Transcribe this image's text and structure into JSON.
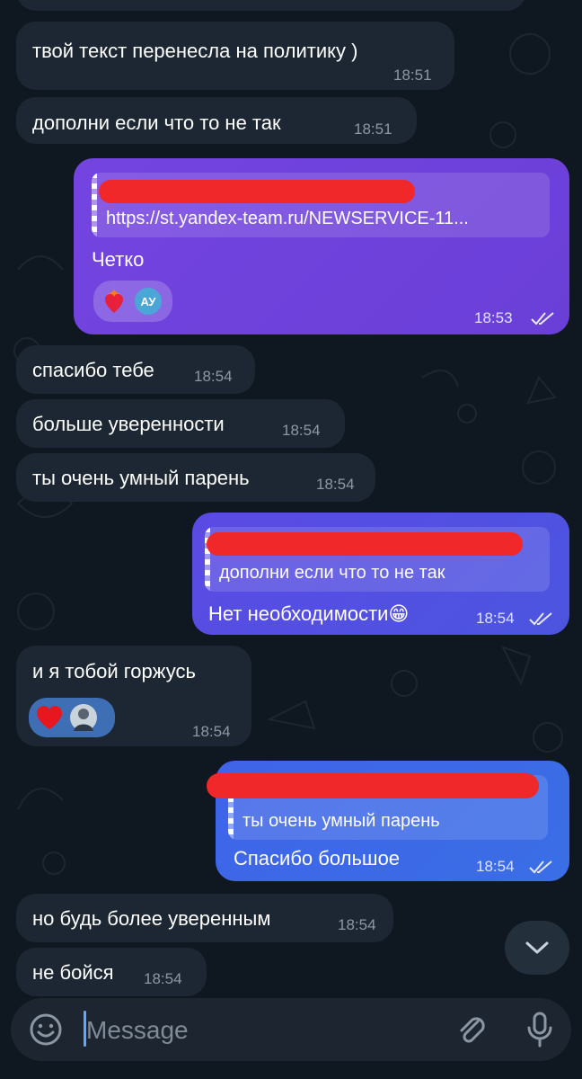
{
  "messages": {
    "m1": {
      "text": "твой текст перенесла на политику )",
      "time": "18:51"
    },
    "m2": {
      "text": "дополни если что то не так",
      "time": "18:51"
    },
    "m3": {
      "reply_preview": "https://st.yandex-team.ru/NEWSERVICE-11...",
      "text": "Четко",
      "time": "18:53",
      "reaction_avatar": "АУ"
    },
    "m4": {
      "text": "спасибо тебе",
      "time": "18:54"
    },
    "m5": {
      "text": "больше уверенности",
      "time": "18:54"
    },
    "m6": {
      "text": "ты очень умный парень",
      "time": "18:54"
    },
    "m7": {
      "reply_preview": "дополни если что то не так",
      "text": "Нет необходимости😁",
      "time": "18:54"
    },
    "m8": {
      "text": "и я тобой горжусь",
      "time": "18:54"
    },
    "m9": {
      "reply_preview": "ты очень умный парень",
      "text": "Спасибо большое",
      "time": "18:54"
    },
    "m10": {
      "text": "но будь более уверенным",
      "time": "18:54"
    },
    "m11": {
      "text": "не бойся",
      "time": "18:54"
    }
  },
  "input": {
    "placeholder": "Message"
  },
  "icons": {
    "emoji": "smiley-icon",
    "attach": "paperclip-icon",
    "mic": "microphone-icon",
    "scroll": "chevron-down-icon",
    "read": "double-check-icon",
    "reaction_heart": "red-heart",
    "reaction_heart_fire": "heart-on-fire"
  },
  "colors": {
    "background": "#0f1820",
    "incoming": "#1d2733",
    "outgoing_purple": "#7444e0",
    "outgoing_indigo": "#5b4ae3",
    "outgoing_blue": "#3f64e8",
    "redaction": "#f0282a"
  }
}
